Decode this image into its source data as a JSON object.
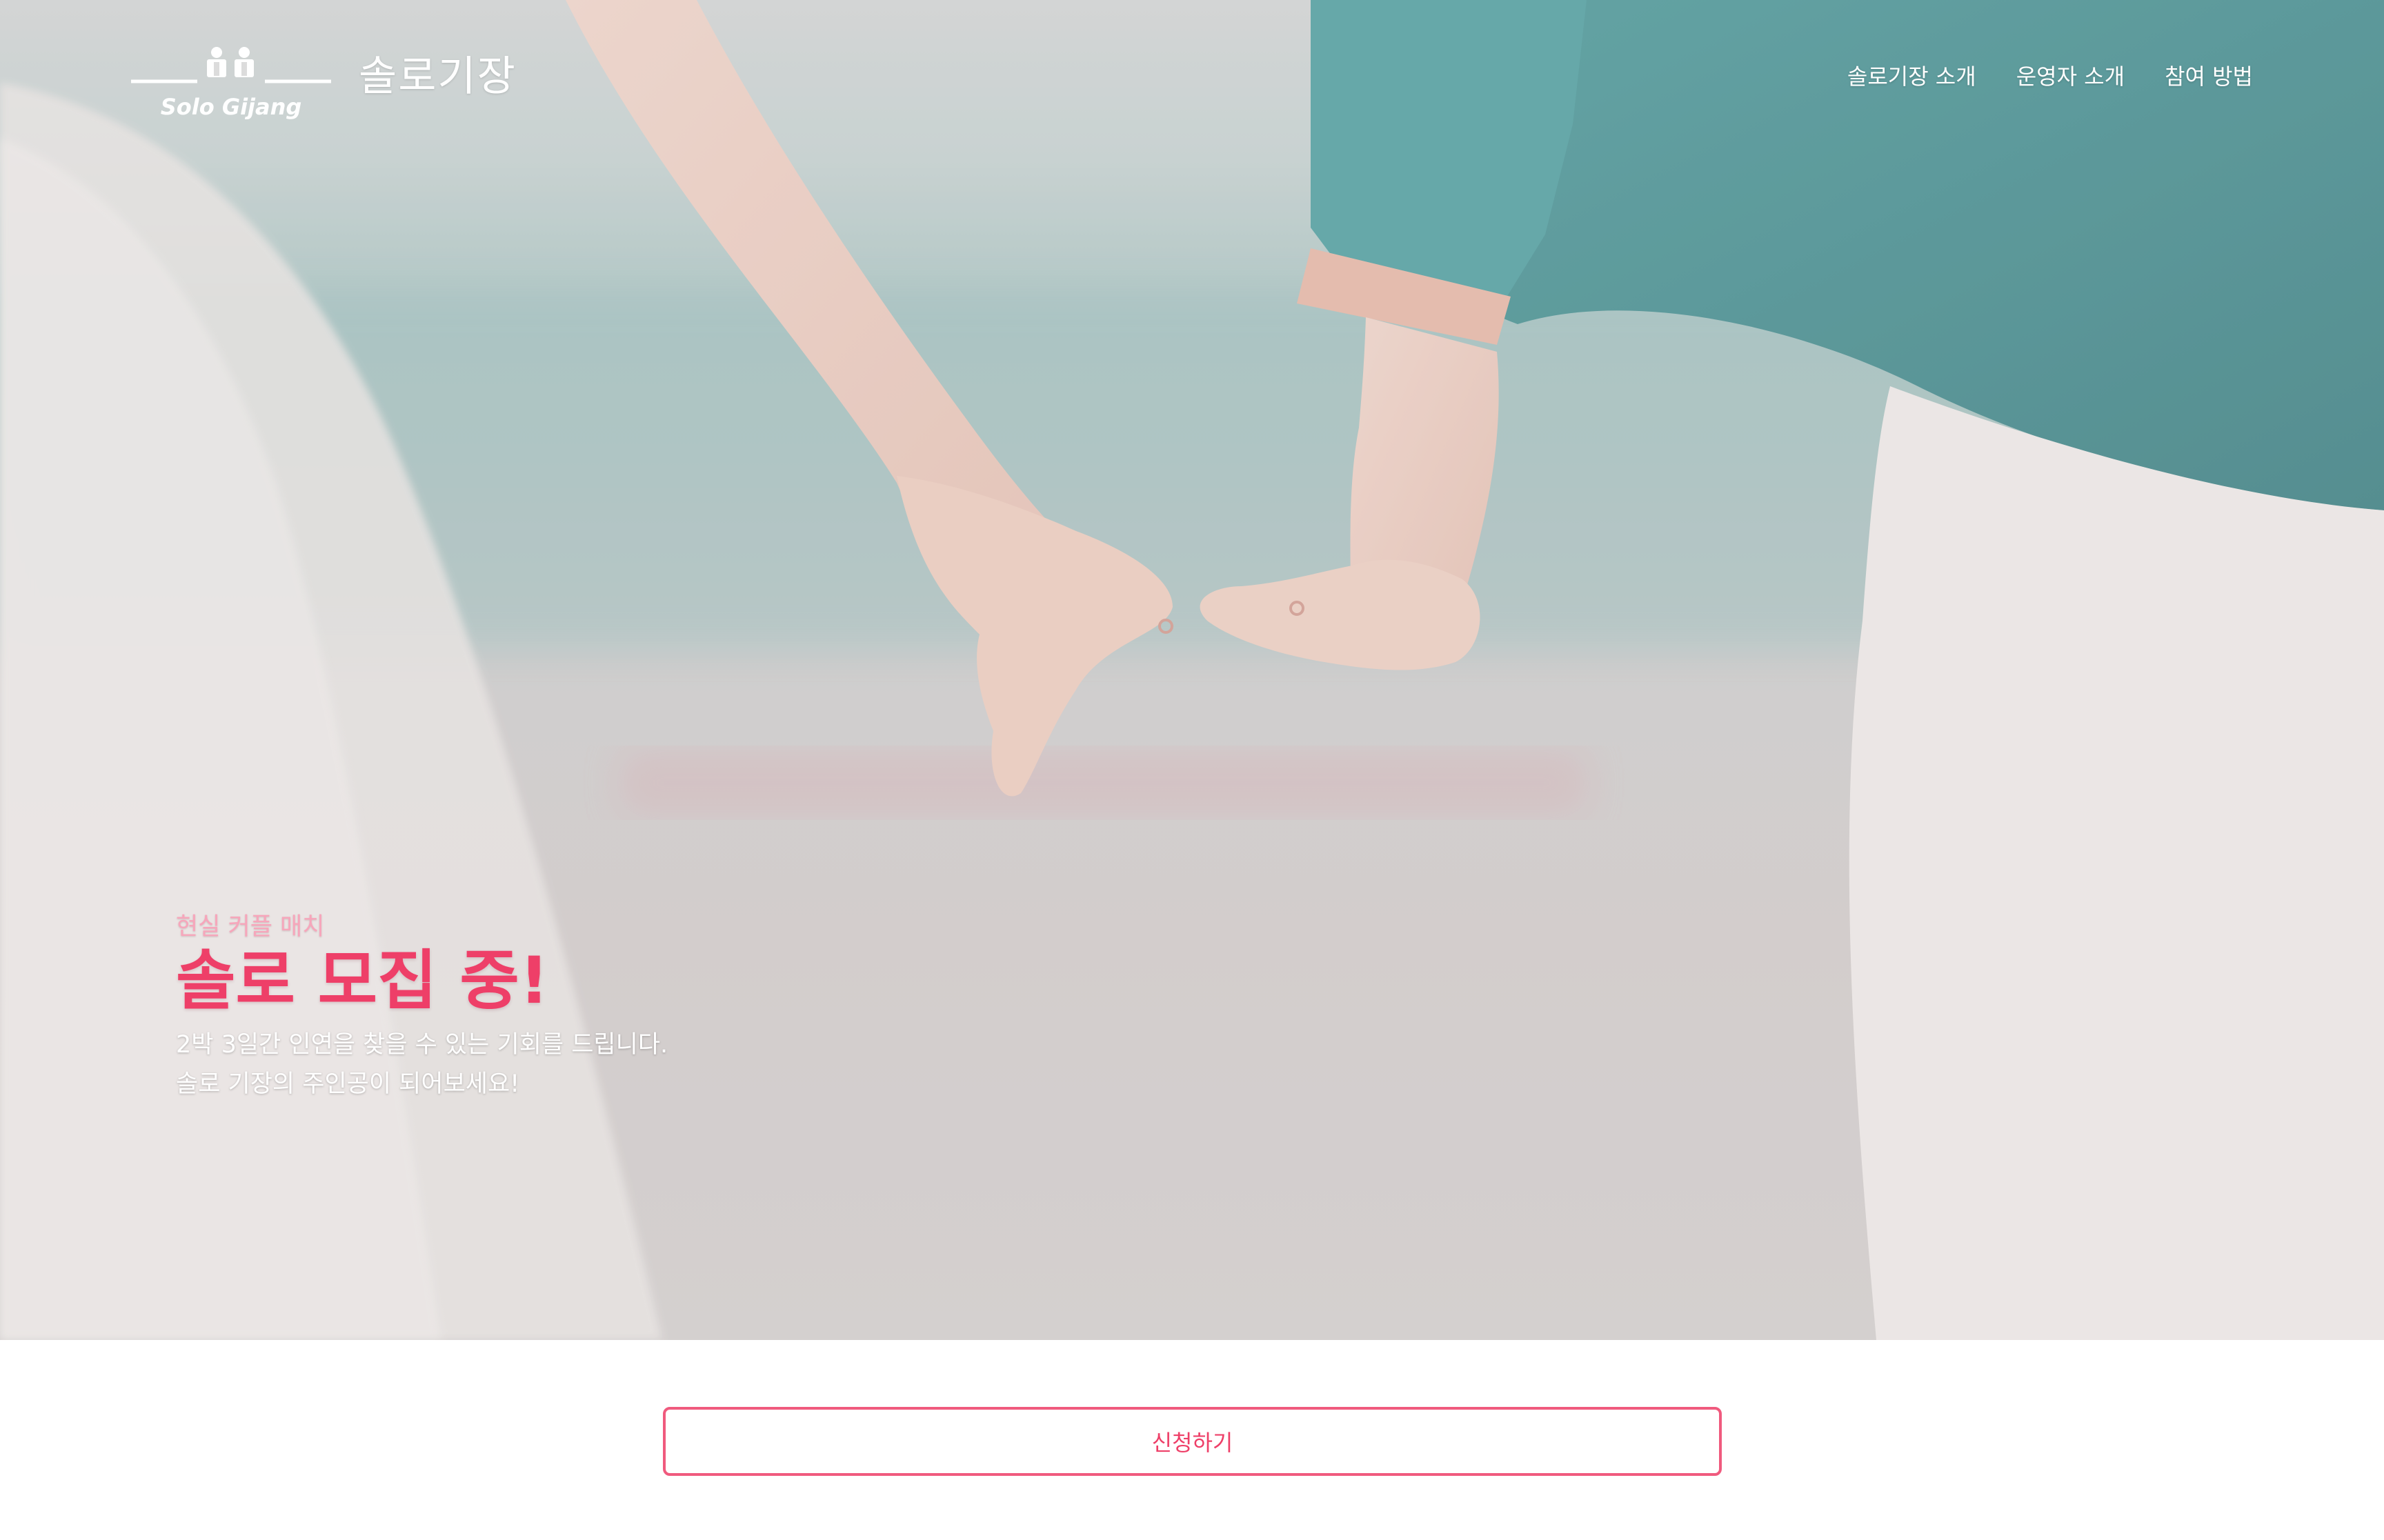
{
  "brand": {
    "logo_text": "Solo Gijang",
    "name": "솔로기장"
  },
  "nav": {
    "items": [
      {
        "label": "솔로기장 소개"
      },
      {
        "label": "운영자 소개"
      },
      {
        "label": "참여 방법"
      }
    ]
  },
  "hero": {
    "eyebrow": "현실 커플 매치",
    "headline": "솔로 모집 중!",
    "desc_line1": "2박 3일간 인연을 찾을 수 있는 기회를 드립니다.",
    "desc_line2": "솔로 기장의 주인공이 되어보세요!",
    "image_icon": "couple-holding-hands-photo"
  },
  "cta": {
    "apply_label": "신청하기"
  },
  "colors": {
    "accent": "#ee3f68",
    "accent_light": "#f7a6bb",
    "button_border": "#f05a7e"
  }
}
